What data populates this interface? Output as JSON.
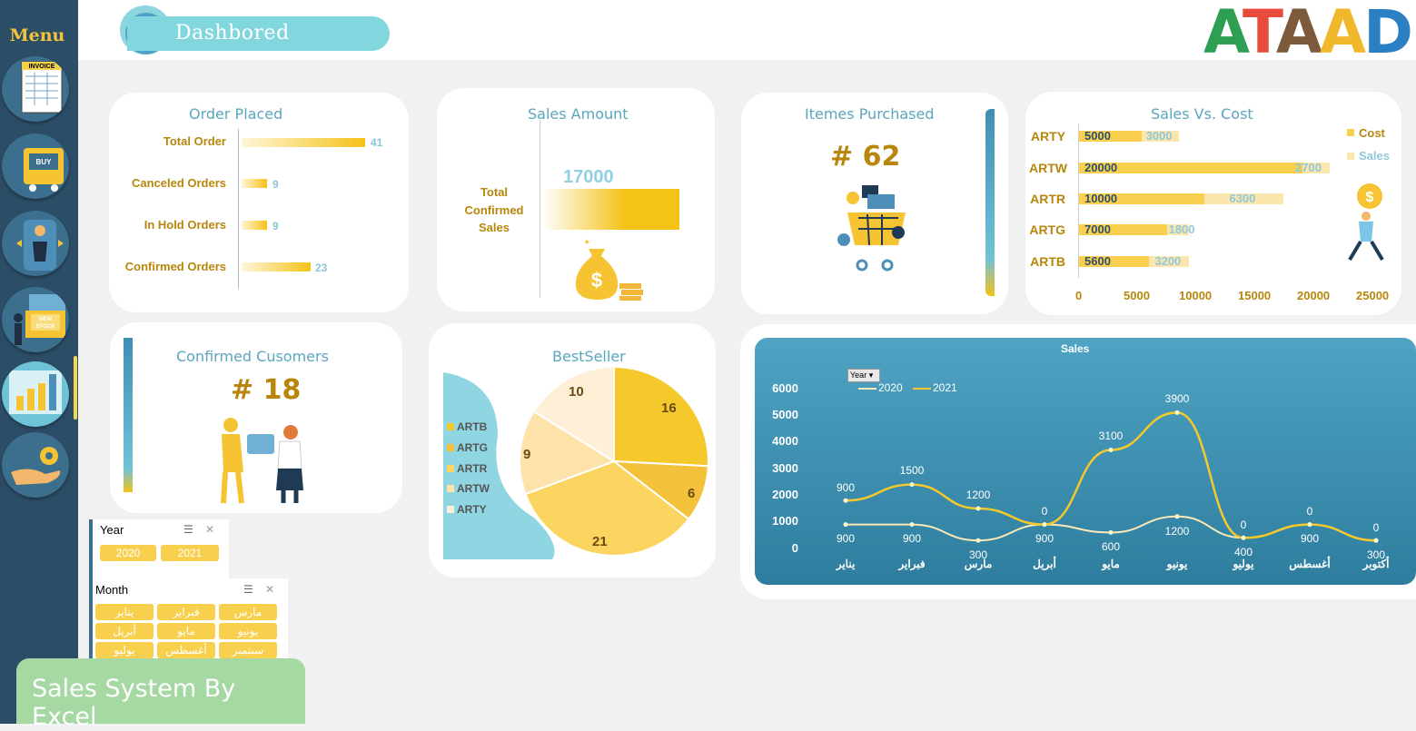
{
  "app": {
    "title": "Dashbored",
    "logo": "ATAAD",
    "footer": "Sales System By Excel"
  },
  "menu": {
    "title": "Menu",
    "items": [
      {
        "name": "invoice-icon",
        "label": "INVOICE"
      },
      {
        "name": "cart-icon",
        "label": "BUY"
      },
      {
        "name": "customer-icon"
      },
      {
        "name": "new-stock-icon",
        "label": "NEW STOCK"
      },
      {
        "name": "dashboard-icon",
        "active": true
      },
      {
        "name": "settings-icon"
      }
    ]
  },
  "order_placed": {
    "title": "Order Placed",
    "rows": [
      {
        "label": "Total Order",
        "value": "41"
      },
      {
        "label": "Canceled Orders",
        "value": "9"
      },
      {
        "label": "In Hold Orders",
        "value": "9"
      },
      {
        "label": "Confirmed Orders",
        "value": "23"
      }
    ]
  },
  "sales_amount": {
    "title": "Sales Amount",
    "label": "Total\nConfirmed\nSales",
    "label_lines": [
      "Total",
      "Confirmed",
      "Sales"
    ],
    "value": "17000"
  },
  "items_purchased": {
    "title": "Itemes Purchased",
    "value": "# 62"
  },
  "sales_vs_cost": {
    "title": "Sales Vs. Cost",
    "legend": [
      "Cost",
      "Sales"
    ],
    "categories": [
      "ARTY",
      "ARTW",
      "ARTR",
      "ARTG",
      "ARTB"
    ],
    "cost": [
      5000,
      20000,
      10000,
      7000,
      5600
    ],
    "sales": [
      3000,
      2700,
      6300,
      1800,
      3200
    ],
    "axis": [
      "0",
      "5000",
      "10000",
      "15000",
      "20000",
      "25000"
    ]
  },
  "confirmed_customers": {
    "title": "Confirmed Cusomers",
    "value": "# 18"
  },
  "bestseller": {
    "title": "BestSeller",
    "legend": [
      "ARTB",
      "ARTG",
      "ARTR",
      "ARTW",
      "ARTY"
    ],
    "slices": [
      {
        "name": "ARTB",
        "value": 16,
        "color": "#f5c92c"
      },
      {
        "name": "ARTG",
        "value": 6,
        "color": "#f3c23a"
      },
      {
        "name": "ARTR",
        "value": 21,
        "color": "#fbd560"
      },
      {
        "name": "ARTW",
        "value": 9,
        "color": "#fde3aa"
      },
      {
        "name": "ARTY",
        "value": 10,
        "color": "#fdf0d6"
      }
    ]
  },
  "slicers": {
    "year": {
      "title": "Year",
      "options": [
        "2020",
        "2021"
      ]
    },
    "month": {
      "title": "Month",
      "options": [
        "يناير",
        "فبراير",
        "مارس",
        "أبريل",
        "مايو",
        "يونيو",
        "يوليو",
        "أغسطس",
        "سبتمبر"
      ]
    }
  },
  "chart_data": {
    "type": "line",
    "title": "Sales",
    "filter_button": "Year",
    "categories": [
      "يناير",
      "فبراير",
      "مارس",
      "أبريل",
      "مايو",
      "يونيو",
      "يوليو",
      "أغسطس",
      "أكتوبر"
    ],
    "series": [
      {
        "name": "2020",
        "values": [
          900,
          900,
          300,
          900,
          600,
          1200,
          400,
          900,
          300
        ],
        "color": "#fbe9b8"
      },
      {
        "name": "2021",
        "values": [
          900,
          1500,
          1200,
          0,
          3100,
          3900,
          0,
          0,
          0
        ],
        "color": "#f5c92c"
      }
    ],
    "plotted_2021": [
      1800,
      2400,
      1500,
      900,
      3700,
      5100,
      400,
      900,
      300
    ],
    "y_ticks": [
      "6000",
      "5000",
      "4000",
      "3000",
      "2000",
      "1000",
      "0"
    ],
    "ylim": [
      0,
      6000
    ],
    "legend": "top-left"
  }
}
